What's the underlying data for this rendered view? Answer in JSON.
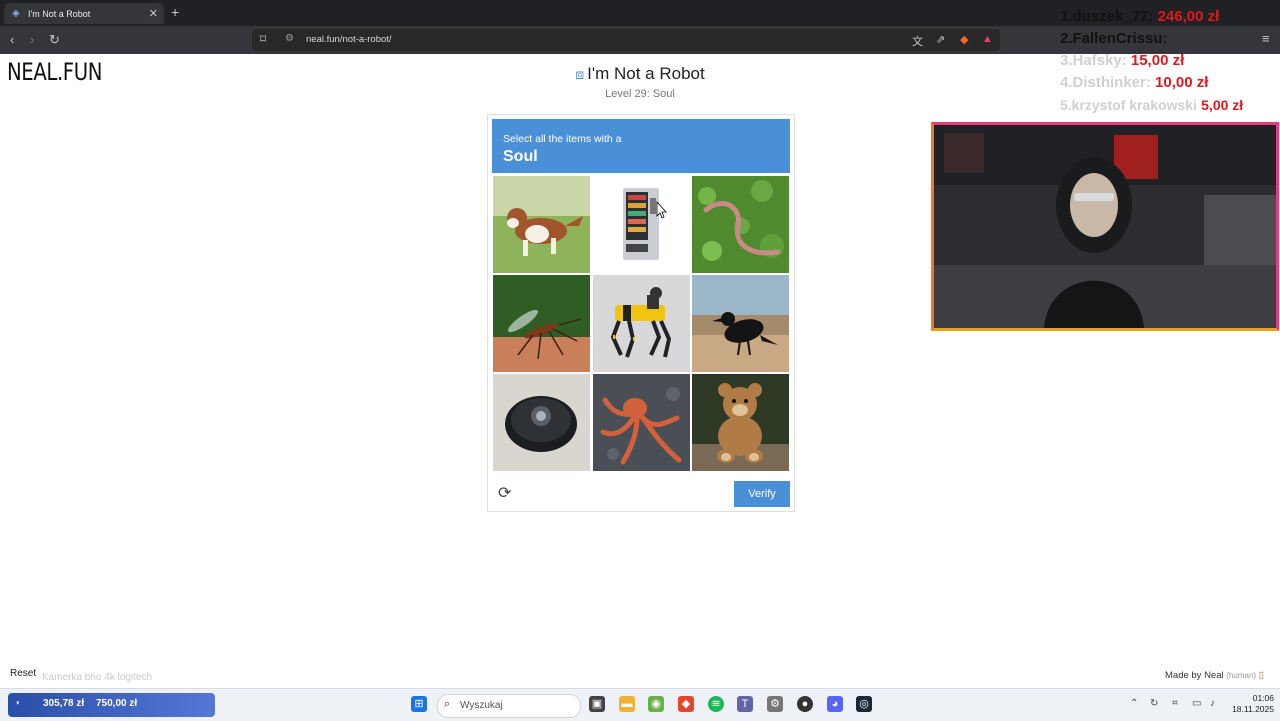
{
  "browser": {
    "tab_title": "I'm Not a Robot",
    "url": "neal.fun/not-a-robot/"
  },
  "page": {
    "logo": "NEAL.FUN",
    "title": "I'm Not a Robot",
    "level": "Level 29: Soul",
    "footer_reset": "Reset",
    "footer_ghost_text": "Kamerka brio 4k logitech",
    "made_by": "Made by Neal",
    "made_by_tag": "(human)"
  },
  "captcha": {
    "instruction": "Select all the items with a",
    "target_word": "Soul",
    "verify_label": "Verify",
    "tiles": [
      {
        "subject": "dog"
      },
      {
        "subject": "vending machine"
      },
      {
        "subject": "earthworm"
      },
      {
        "subject": "mosquito"
      },
      {
        "subject": "robot dog"
      },
      {
        "subject": "crow"
      },
      {
        "subject": "robot vacuum"
      },
      {
        "subject": "octopus"
      },
      {
        "subject": "teddy bear"
      }
    ]
  },
  "donations": [
    {
      "name": "1.duszek_77:",
      "amount": "246,00 zł"
    },
    {
      "name": "2.FallenCrissu:",
      "amount": ""
    },
    {
      "name": "3.Hafsky:",
      "amount": "15,00 zł"
    },
    {
      "name": "4.Disthinker:",
      "amount": "10,00 zł"
    },
    {
      "name": "5.krzystof krakowski",
      "amount": "5,00 zł"
    }
  ],
  "taskbar": {
    "widget_amount_1": "305,78 zł",
    "widget_amount_2": "750,00 zł",
    "search_placeholder": "Wyszukaj",
    "time": "01:06",
    "date": "18.11.2025"
  },
  "colors": {
    "accent": "#4a90d9",
    "donation_amount": "#e0191c"
  }
}
